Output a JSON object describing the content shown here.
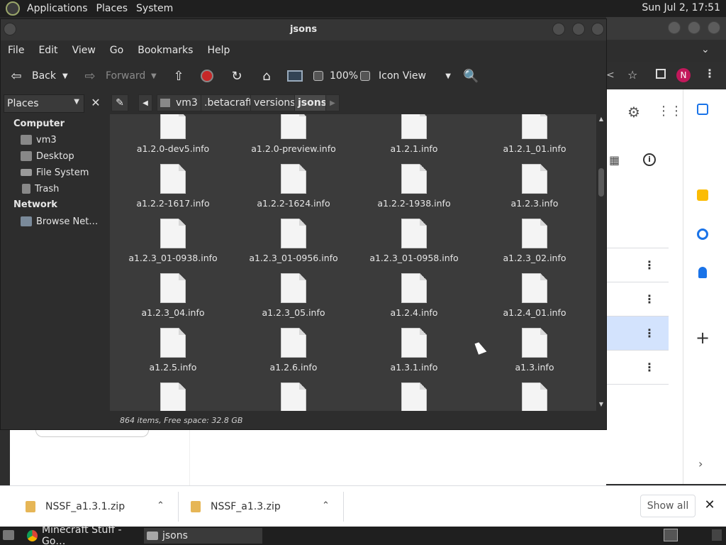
{
  "top_panel": {
    "menus": [
      "Applications",
      "Places",
      "System"
    ],
    "clock": "Sun Jul  2, 17:51"
  },
  "file_manager": {
    "title": "jsons",
    "menubar": [
      "File",
      "Edit",
      "View",
      "Go",
      "Bookmarks",
      "Help"
    ],
    "toolbar": {
      "back_label": "Back",
      "forward_label": "Forward",
      "zoom": "100%",
      "view_mode": "Icon View"
    },
    "sidebar": {
      "selector_label": "Places",
      "computer_heading": "Computer",
      "computer_items": [
        {
          "label": "vm3",
          "icon": "home-folder-icon"
        },
        {
          "label": "Desktop",
          "icon": "desktop-icon"
        },
        {
          "label": "File System",
          "icon": "drive-icon"
        },
        {
          "label": "Trash",
          "icon": "trash-icon"
        }
      ],
      "network_heading": "Network",
      "network_items": [
        {
          "label": "Browse Net…",
          "icon": "network-icon"
        }
      ]
    },
    "path": [
      "vm3",
      ".betacraft",
      "versions",
      "jsons"
    ],
    "files": [
      "a1.2.0-dev5.info",
      "a1.2.0-preview.info",
      "a1.2.1.info",
      "a1.2.1_01.info",
      "a1.2.2-1617.info",
      "a1.2.2-1624.info",
      "a1.2.2-1938.info",
      "a1.2.3.info",
      "a1.2.3_01-0938.info",
      "a1.2.3_01-0956.info",
      "a1.2.3_01-0958.info",
      "a1.2.3_02.info",
      "a1.2.3_04.info",
      "a1.2.3_05.info",
      "a1.2.4.info",
      "a1.2.4_01.info",
      "a1.2.5.info",
      "a1.2.6.info",
      "a1.3.1.info",
      "a1.3.info",
      "",
      "",
      "",
      ""
    ],
    "status": "864 items, Free space: 32.8 GB"
  },
  "downloads": {
    "items": [
      "NSSF_a1.3.1.zip",
      "NSSF_a1.3.zip"
    ],
    "show_all": "Show all",
    "close": "✕"
  },
  "taskbar": {
    "tasks": [
      "Minecraft Stuff - Go…",
      "jsons"
    ]
  },
  "colors": {
    "panel": "#1f1f1f",
    "window_bg": "#2d2d2d",
    "icon_view_bg": "#3b3b3b",
    "selected_row": "#d3e3fd",
    "zip_icon": "#e6b656"
  }
}
